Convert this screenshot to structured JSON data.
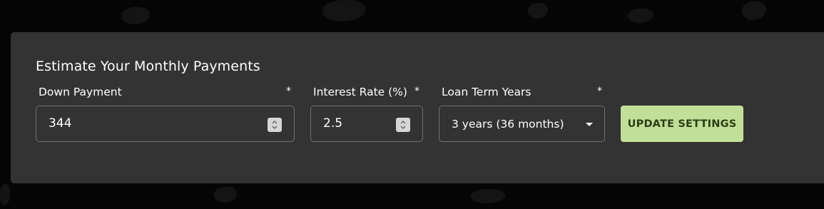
{
  "form": {
    "title": "Estimate Your Monthly Payments",
    "required_marker": "*",
    "down_payment": {
      "label": "Down Payment",
      "value": "344"
    },
    "interest_rate": {
      "label": "Interest Rate (%)",
      "value": "2.5"
    },
    "loan_term": {
      "label": "Loan Term Years",
      "selected": "3 years (36 months)"
    },
    "update_button": "UPDATE SETTINGS"
  },
  "colors": {
    "page_background": "#050505",
    "panel_background": "#333333",
    "field_border": "#707070",
    "button_background": "#c2df99",
    "button_text": "#2b3e13",
    "text": "#ffffff"
  },
  "icons": {
    "spinner": "up-down-spinner-icon",
    "dropdown": "caret-down-icon"
  }
}
